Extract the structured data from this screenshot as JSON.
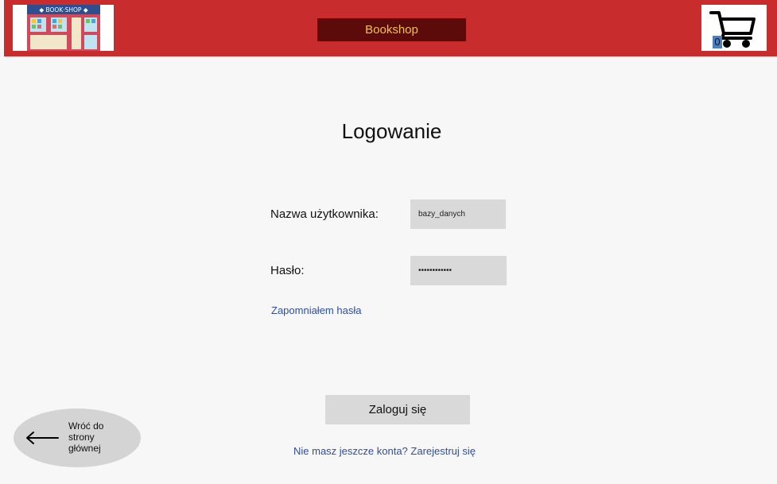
{
  "header": {
    "brand_label": "Bookshop",
    "logo_text": "◆ BOOK·SHOP ◆",
    "cart_count": "0"
  },
  "login": {
    "title": "Logowanie",
    "username_label": "Nazwa użytkownika:",
    "username_value": "bazy_danych",
    "password_label": "Hasło:",
    "password_value": "••••••••••••",
    "forgot_link": "Zapomniałem hasła",
    "submit_label": "Zaloguj się",
    "register_link": "Nie masz jeszcze konta? Zarejestruj się"
  },
  "back": {
    "line1": "Wróć do",
    "line2": "strony",
    "line3": "głównej"
  },
  "colors": {
    "header_bg": "#c82c2c",
    "brand_bg": "#5c0a0a",
    "brand_text": "#f0c24a",
    "link": "#2f4ea3",
    "field_bg": "#d9d9d9"
  }
}
